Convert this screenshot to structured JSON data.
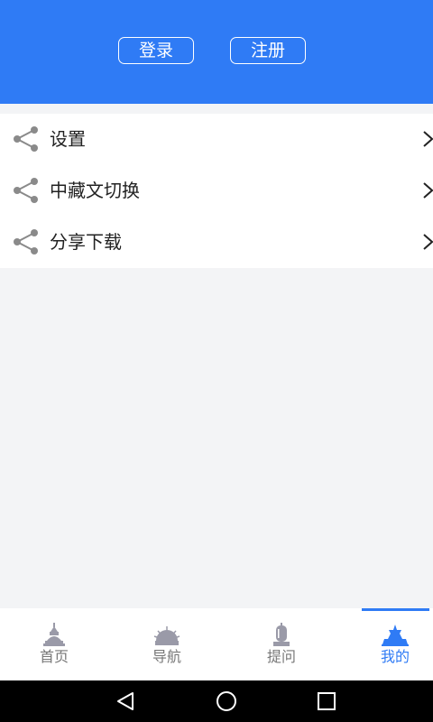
{
  "header": {
    "login_label": "登录",
    "register_label": "注册",
    "color": "#2f7bf5"
  },
  "menu": {
    "items": [
      {
        "label": "设置",
        "icon": "share-icon"
      },
      {
        "label": "中藏文切换",
        "icon": "share-icon"
      },
      {
        "label": "分享下载",
        "icon": "share-icon"
      }
    ]
  },
  "tabbar": {
    "active": "我的",
    "tabs": [
      {
        "label": "首页",
        "icon": "stupa-icon"
      },
      {
        "label": "导航",
        "icon": "dharma-wheel-icon"
      },
      {
        "label": "提问",
        "icon": "prayer-wheel-icon"
      },
      {
        "label": "我的",
        "icon": "palace-icon"
      }
    ]
  },
  "system_nav": {
    "buttons": [
      "back-icon",
      "home-icon",
      "recents-icon"
    ]
  }
}
